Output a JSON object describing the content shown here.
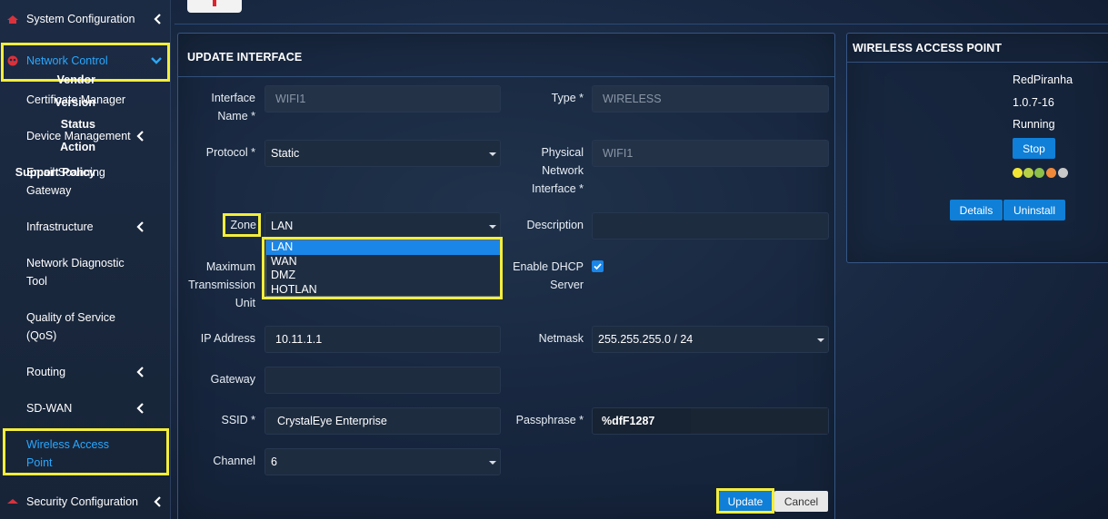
{
  "sidebar": {
    "items": [
      {
        "label": "System Configuration"
      },
      {
        "label": "Network Control"
      },
      {
        "label": "Certificate Manager"
      },
      {
        "label": "Device Management"
      },
      {
        "label": "Email Scanning Gateway",
        "line1": "Email Scanning",
        "line2": "Gateway"
      },
      {
        "label": "Infrastructure"
      },
      {
        "label": "Network Diagnostic Tool",
        "line1": "Network Diagnostic",
        "line2": "Tool"
      },
      {
        "label": "Quality of Service (QoS)",
        "line1": "Quality of Service",
        "line2": "(QoS)"
      },
      {
        "label": "Routing"
      },
      {
        "label": "SD-WAN"
      },
      {
        "label": "Wireless Access Point",
        "line1": "Wireless Access",
        "line2": "Point"
      },
      {
        "label": "Security Configuration"
      }
    ]
  },
  "form": {
    "title": "UPDATE INTERFACE",
    "interface_name_label_1": "Interface",
    "interface_name_label_2": "Name *",
    "interface_name_value": "WIFI1",
    "type_label": "Type *",
    "type_value": "WIRELESS",
    "protocol_label": "Protocol *",
    "protocol_value": "Static",
    "physical_label_1": "Physical",
    "physical_label_2": "Network",
    "physical_label_3": "Interface *",
    "physical_value": "WIFI1",
    "zone_label": "Zone",
    "zone_value": "LAN",
    "zone_options": [
      "LAN",
      "WAN",
      "DMZ",
      "HOTLAN"
    ],
    "description_label": "Description",
    "description_value": "",
    "mtu_label_1": "Maximum",
    "mtu_label_2": "Transmission",
    "mtu_label_3": "Unit",
    "dhcp_label_1": "Enable DHCP",
    "dhcp_label_2": "Server",
    "dhcp_checked": true,
    "ip_label": "IP Address",
    "ip_value": "10.11.1.1",
    "netmask_label": "Netmask",
    "netmask_value": "255.255.255.0 / 24",
    "gateway_label": "Gateway",
    "gateway_value": "",
    "ssid_label": "SSID *",
    "ssid_value": "CrystalEye Enterprise",
    "passphrase_label": "Passphrase *",
    "passphrase_value": "%dfF1287",
    "channel_label": "Channel",
    "channel_value": "6",
    "update_label": "Update",
    "cancel_label": "Cancel"
  },
  "wap": {
    "title": "WIRELESS ACCESS POINT",
    "vendor_label": "Vendor",
    "vendor_value": "RedPiranha",
    "version_label": "Version",
    "version_value": "1.0.7-16",
    "status_label": "Status",
    "status_value": "Running",
    "action_label": "Action",
    "stop_label": "Stop",
    "support_label": "Support Policy",
    "support_dots": [
      "#f2e634",
      "#b8d048",
      "#8cc04a",
      "#f08a3a",
      "#c8c8c8"
    ],
    "details_label": "Details",
    "uninstall_label": "Uninstall"
  },
  "colors": {
    "accent": "#1a86e8",
    "highlight": "#f4ee3b",
    "active_nav": "#29a8ff"
  }
}
